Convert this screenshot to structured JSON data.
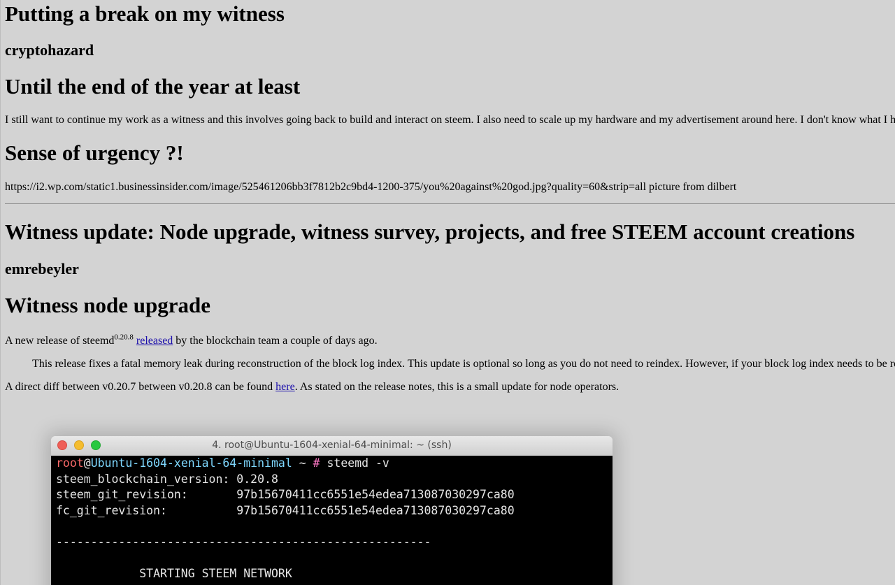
{
  "post1": {
    "title": "Putting a break on my witness",
    "author": "cryptohazard",
    "heading": "Until the end of the year at least",
    "paragraph": "I still want to continue my work as a witness and this involves going back to build and interact on steem. I also need to scale up my hardware and my advertisement around here. I don't know what I have th",
    "heading2": "Sense of urgency ?!",
    "image_text": "https://i2.wp.com/static1.businessinsider.com/image/525461206bb3f7812b2c9bd4-1200-375/you%20against%20god.jpg?quality=60&strip=all picture from dilbert"
  },
  "post2": {
    "title": "Witness update: Node upgrade, witness survey, projects, and free STEEM account creations",
    "author": "emrebeyler",
    "heading": "Witness node upgrade",
    "para1_prefix": "A new release of steemd",
    "para1_sup": "0.20.8",
    "para1_link": "released",
    "para1_suffix": " by the blockchain team a couple of days ago.",
    "quote": "This release fixes a fatal memory leak during reconstruction of the block log index. This update is optional so long as you do not need to reindex. However, if your block log index needs to be recons",
    "para2_prefix": "A direct diff between v0.20.7 between v0.20.8 can be found ",
    "para2_link": "here",
    "para2_suffix": ". As stated on the release notes, this is a small update for node operators."
  },
  "terminal": {
    "title": "4. root@Ubuntu-1604-xenial-64-minimal: ~ (ssh)",
    "prompt_user": "root",
    "prompt_at": "@",
    "prompt_host": "Ubuntu-1604-xenial-64-minimal",
    "prompt_path": " ~ ",
    "prompt_hash": "#",
    "command": " steemd -v",
    "lines": [
      "steem_blockchain_version: 0.20.8",
      "steem_git_revision:       97b15670411cc6551e54edea713087030297ca80",
      "fc_git_revision:          97b15670411cc6551e54edea713087030297ca80",
      "",
      "------------------------------------------------------",
      "",
      "            STARTING STEEM NETWORK"
    ]
  }
}
